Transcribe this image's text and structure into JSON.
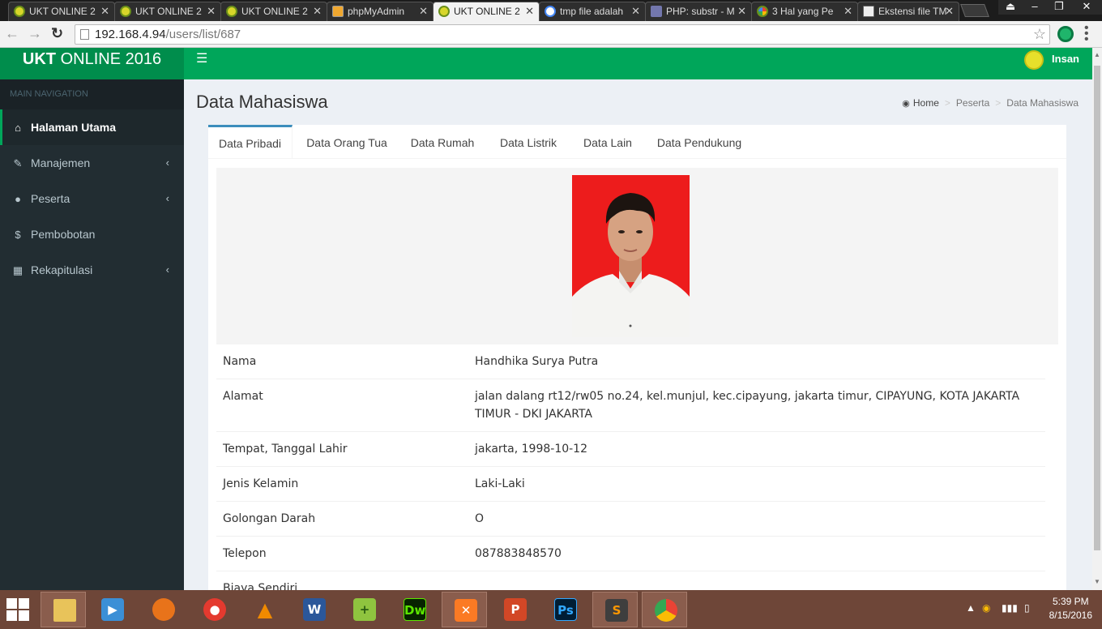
{
  "browser": {
    "tabs": [
      {
        "label": "UKT ONLINE 2",
        "icon": "ukt-favicon",
        "active": false
      },
      {
        "label": "UKT ONLINE 2",
        "icon": "ukt-favicon",
        "active": false
      },
      {
        "label": "UKT ONLINE 2",
        "icon": "ukt-favicon",
        "active": false
      },
      {
        "label": "phpMyAdmin",
        "icon": "phpmyadmin-favicon",
        "active": false
      },
      {
        "label": "UKT ONLINE 2",
        "icon": "ukt-favicon",
        "active": true
      },
      {
        "label": "tmp file adalah",
        "icon": "google-favicon",
        "active": false
      },
      {
        "label": "PHP: substr - M",
        "icon": "php-favicon",
        "active": false
      },
      {
        "label": "3 Hal yang Pe",
        "icon": "colorful-favicon",
        "active": false
      },
      {
        "label": "Ekstensi file TM",
        "icon": "document-favicon",
        "active": false
      }
    ],
    "url_host": "192.168.4.94",
    "url_path": "/users/list/687"
  },
  "app": {
    "logo_bold": "UKT",
    "logo_rest": " ONLINE 2016",
    "user_name": "Insan"
  },
  "sidebar": {
    "header": "MAIN NAVIGATION",
    "items": [
      {
        "label": "Halaman Utama",
        "icon": "home-icon",
        "active": true,
        "has_children": false
      },
      {
        "label": "Manajemen",
        "icon": "edit-icon",
        "active": false,
        "has_children": true
      },
      {
        "label": "Peserta",
        "icon": "user-icon",
        "active": false,
        "has_children": true
      },
      {
        "label": "Pembobotan",
        "icon": "dollar-icon",
        "active": false,
        "has_children": false
      },
      {
        "label": "Rekapitulasi",
        "icon": "table-icon",
        "active": false,
        "has_children": true
      }
    ]
  },
  "page": {
    "title": "Data Mahasiswa",
    "breadcrumb": [
      "Home",
      "Peserta",
      "Data Mahasiswa"
    ]
  },
  "tabs": [
    {
      "label": "Data Pribadi",
      "active": true
    },
    {
      "label": "Data Orang Tua",
      "active": false
    },
    {
      "label": "Data Rumah",
      "active": false
    },
    {
      "label": "Data Listrik",
      "active": false
    },
    {
      "label": "Data Lain",
      "active": false
    },
    {
      "label": "Data Pendukung",
      "active": false
    }
  ],
  "details": [
    {
      "label": "Nama",
      "value": "Handhika Surya Putra"
    },
    {
      "label": "Alamat",
      "value": "jalan dalang rt12/rw05 no.24, kel.munjul, kec.cipayung, jakarta timur, CIPAYUNG, KOTA JAKARTA TIMUR - DKI JAKARTA"
    },
    {
      "label": "Tempat, Tanggal Lahir",
      "value": "jakarta, 1998-10-12"
    },
    {
      "label": "Jenis Kelamin",
      "value": "Laki-Laki"
    },
    {
      "label": "Golongan Darah",
      "value": "O"
    },
    {
      "label": "Telepon",
      "value": "087883848570"
    },
    {
      "label": "Biaya Sendiri",
      "value": ""
    }
  ],
  "taskbar": {
    "apps": [
      "file-explorer-icon",
      "media-player-icon",
      "firefox-icon",
      "screen-recorder-icon",
      "vlc-icon",
      "word-icon",
      "notepad-plus-plus-icon",
      "dreamweaver-icon",
      "xampp-icon",
      "powerpoint-icon",
      "photoshop-icon",
      "sublime-text-icon",
      "chrome-icon"
    ],
    "time": "5:39 PM",
    "date": "8/15/2016"
  },
  "colors": {
    "header_green": "#00a65a",
    "logo_green": "#008d4c",
    "sidebar_dark": "#222d32",
    "tab_accent": "#3c8dbc",
    "photo_background_red": "#ed1c1c"
  }
}
